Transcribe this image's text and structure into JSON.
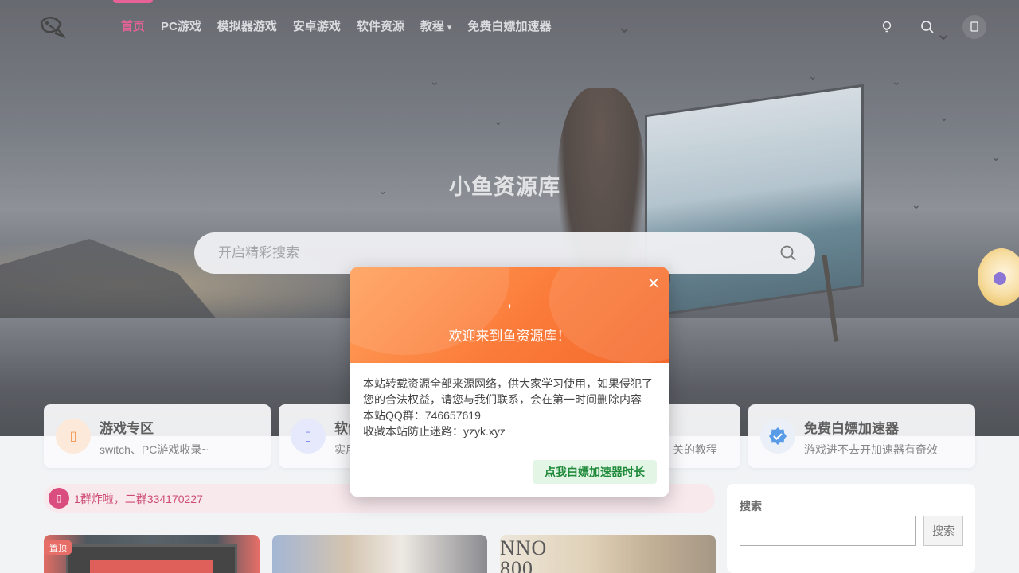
{
  "site": {
    "title": "小鱼资源库",
    "search_placeholder": "开启精彩搜索"
  },
  "nav": {
    "items": [
      {
        "label": "首页",
        "active": true
      },
      {
        "label": "PC游戏"
      },
      {
        "label": "模拟器游戏"
      },
      {
        "label": "安卓游戏"
      },
      {
        "label": "软件资源"
      },
      {
        "label": "教程",
        "caret": "▾"
      },
      {
        "label": "免费白嫖加速器"
      }
    ]
  },
  "toolbar": {
    "icons": [
      "lightbulb-icon",
      "search-icon",
      "user-icon"
    ]
  },
  "cards": [
    {
      "title": "游戏专区",
      "desc": "switch、PC游戏收录~",
      "icon": "gamepad-icon",
      "icon_bg": "#fbe3cf",
      "icon_color": "#f07a22"
    },
    {
      "title": "软件",
      "desc": "实用",
      "icon": "app-icon",
      "icon_bg": "#dfe3fb",
      "icon_color": "#4a5ee0"
    },
    {
      "title": "",
      "desc": "关的教程",
      "icon": "book-icon",
      "icon_bg": "#fce5d3",
      "icon_color": "#e07a22"
    },
    {
      "title": "免费白嫖加速器",
      "desc": "游戏进不去开加速器有奇效",
      "icon": "check-badge-icon",
      "icon_bg": "#e6ecf7",
      "icon_color": "#2a7fe0"
    }
  ],
  "notice": {
    "text": "1群炸啦，二群334170227",
    "icon": "bell-icon"
  },
  "sidebar_search": {
    "title": "搜索",
    "button": "搜索"
  },
  "posts": [
    {
      "badge": "置顶"
    }
  ],
  "modal": {
    "comma": ",",
    "welcome": "欢迎来到鱼资源库！",
    "close": "×",
    "body_lines": [
      "本站转载资源全部来源网络，供大家学习使用，如果侵犯了",
      "您的合法权益，请您与我们联系，会在第一时间删除内容",
      "本站QQ群：746657619",
      "收藏本站防止迷路：yzyk.xyz"
    ],
    "button": "点我白嫖加速器时长"
  },
  "colors": {
    "accent": "#e0367a",
    "modal_header": "#fb7b3a",
    "modal_button_bg": "#e3f6e6",
    "modal_button_text": "#1f8a3a",
    "notice_text": "#c01850"
  }
}
